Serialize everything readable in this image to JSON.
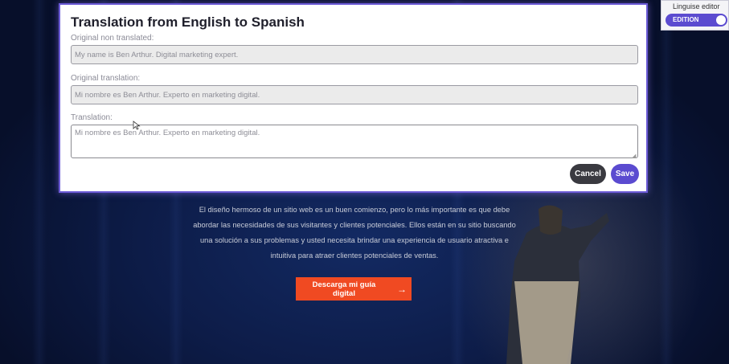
{
  "modal": {
    "title": "Translation from English to Spanish",
    "original_label": "Original non translated:",
    "original_value": "My name is Ben Arthur. Digital marketing expert.",
    "original_translation_label": "Original translation:",
    "original_translation_value": "Mi nombre es Ben Arthur. Experto en marketing digital.",
    "translation_label": "Translation:",
    "translation_value": "Mi nombre es Ben Arthur. Experto en marketing digital.",
    "cancel_label": "Cancel",
    "save_label": "Save"
  },
  "editor": {
    "label": "Linguise editor",
    "toggle_label": "EDITION",
    "toggle_on": true
  },
  "hero": {
    "paragraph": "El diseño hermoso de un sitio web es un buen comienzo, pero lo más importante es que debe abordar las necesidades de sus visitantes y clientes potenciales. Ellos están en su sitio buscando una solución a sus problemas y usted necesita brindar una experiencia de usuario atractiva e intuitiva para atraer clientes potenciales de ventas.",
    "cta_label": "Descarga mi guía digital",
    "cta_icon": "arrow-right-icon"
  },
  "colors": {
    "accent": "#5b4bd0",
    "cta": "#f04a22",
    "background": "#0d1c48"
  }
}
